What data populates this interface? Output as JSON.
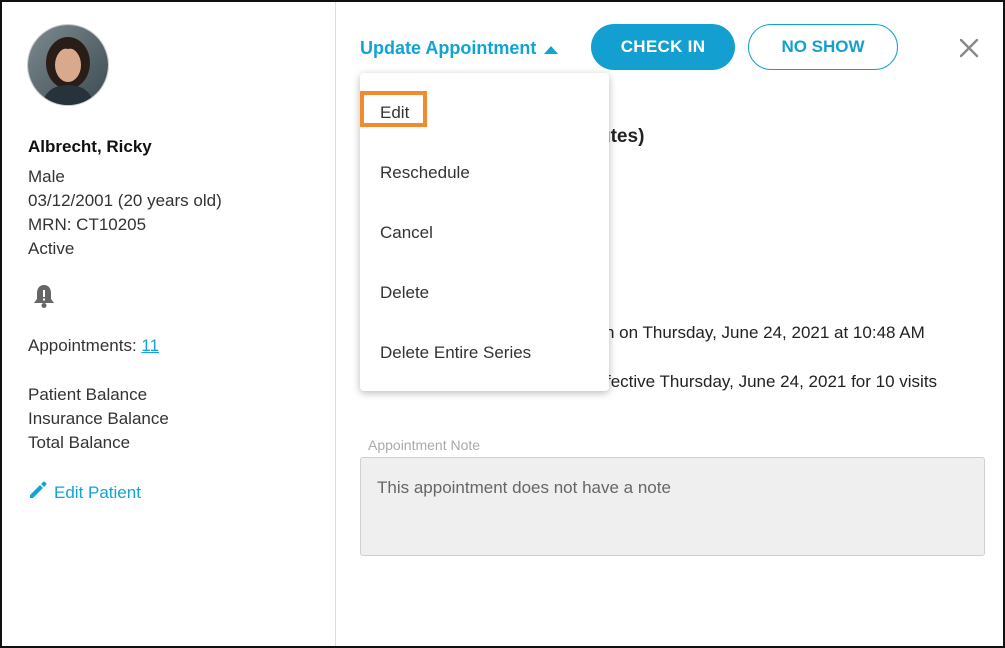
{
  "patient": {
    "name": "Albrecht, Ricky",
    "sex": "Male",
    "dob": "03/12/2001 (20 years old)",
    "mrn": "MRN: CT10205",
    "status": "Active",
    "appointments_label": "Appointments:",
    "appointments_count": "11",
    "patient_balance": "Patient Balance",
    "insurance_balance": "Insurance Balance",
    "total_balance": "Total Balance",
    "edit_label": "Edit Patient"
  },
  "header": {
    "update_label": "Update Appointment",
    "checkin_label": "CHECK IN",
    "noshow_label": "NO SHOW"
  },
  "dropdown": {
    "items": [
      {
        "label": "Edit"
      },
      {
        "label": "Reschedule"
      },
      {
        "label": "Cancel"
      },
      {
        "label": "Delete"
      },
      {
        "label": "Delete Entire Series"
      }
    ]
  },
  "background": {
    "duration_fragment": "utes)",
    "created_fragment": "h on Thursday, June 24, 2021 at 10:48 AM",
    "series_fragment": "fective Thursday, June 24, 2021 for 10 visits"
  },
  "note": {
    "label": "Appointment Note",
    "text": "This appointment does not have a note"
  },
  "colors": {
    "accent": "#139fd0",
    "highlight": "#f28a2e"
  }
}
